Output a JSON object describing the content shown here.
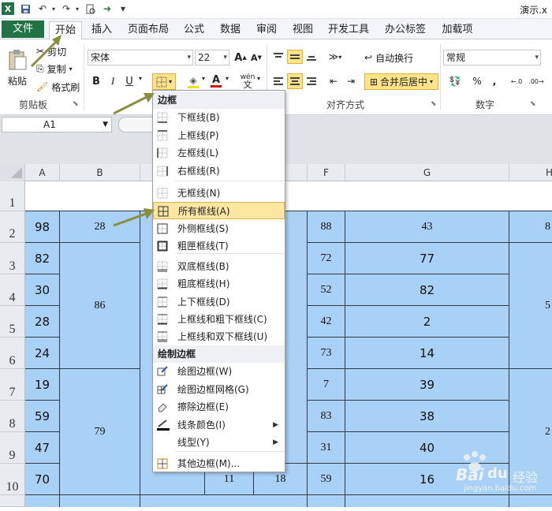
{
  "title_bar": {
    "app_title": "演示.x",
    "qat_icons": [
      "excel-app-icon",
      "save-icon",
      "undo-icon",
      "redo-icon",
      "print-preview-icon",
      "forward-icon",
      "customize-qat-icon"
    ]
  },
  "tabs": [
    "文件",
    "开始",
    "插入",
    "页面布局",
    "公式",
    "数据",
    "审阅",
    "视图",
    "开发工具",
    "办公标签",
    "加载项"
  ],
  "ribbon": {
    "clipboard": {
      "paste": "粘贴",
      "cut": "剪切",
      "copy": "复制",
      "format_painter": "格式刷",
      "group": "剪贴板"
    },
    "font": {
      "font_name": "宋体",
      "font_size": "22",
      "bold": "B",
      "italic": "I",
      "underline": "U",
      "grow": "A",
      "shrink": "A",
      "fill_label": "A",
      "font_color": "A",
      "phonetic": "wén"
    },
    "alignment": {
      "wrap_text": "自动换行",
      "merge_center": "合并后居中",
      "group": "对齐方式"
    },
    "number": {
      "format": "常规",
      "percent": "%",
      "comma": ",",
      "group": "数字"
    }
  },
  "formula_bar": {
    "name_box": "A1"
  },
  "columns": [
    "A",
    "B",
    "C",
    "D",
    "E",
    "F",
    "G",
    "H"
  ],
  "rows": [
    "1",
    "2",
    "3",
    "4",
    "5",
    "6",
    "7",
    "8",
    "9",
    "10"
  ],
  "cells": {
    "A": [
      "98",
      "82",
      "30",
      "28",
      "24",
      "19",
      "59",
      "47",
      "70"
    ],
    "B_merged": [
      "28",
      "86",
      "79"
    ],
    "D10": "11",
    "E10": "18",
    "F": [
      "88",
      "72",
      "52",
      "42",
      "73",
      "7",
      "83",
      "31",
      "59"
    ],
    "G": [
      "43",
      "77",
      "82",
      "2",
      "14",
      "39",
      "38",
      "40",
      "16"
    ],
    "H": [
      "8",
      "5",
      "2"
    ]
  },
  "menu": {
    "header_border": "边框",
    "items_border": [
      {
        "label": "下框线(B)",
        "icon": "bottom-border-icon"
      },
      {
        "label": "上框线(P)",
        "icon": "top-border-icon"
      },
      {
        "label": "左框线(L)",
        "icon": "left-border-icon"
      },
      {
        "label": "右框线(R)",
        "icon": "right-border-icon"
      },
      {
        "label": "无框线(N)",
        "icon": "no-border-icon"
      },
      {
        "label": "所有框线(A)",
        "icon": "all-borders-icon"
      },
      {
        "label": "外侧框线(S)",
        "icon": "outside-borders-icon"
      },
      {
        "label": "粗匣框线(T)",
        "icon": "thick-box-border-icon"
      },
      {
        "label": "双底框线(B)",
        "icon": "double-bottom-border-icon"
      },
      {
        "label": "粗底框线(H)",
        "icon": "thick-bottom-border-icon"
      },
      {
        "label": "上下框线(D)",
        "icon": "top-bottom-border-icon"
      },
      {
        "label": "上框线和粗下框线(C)",
        "icon": "top-thick-bottom-border-icon"
      },
      {
        "label": "上框线和双下框线(U)",
        "icon": "top-double-bottom-border-icon"
      }
    ],
    "header_draw": "绘制边框",
    "items_draw": [
      {
        "label": "绘图边框(W)",
        "icon": "draw-border-icon"
      },
      {
        "label": "绘图边框网格(G)",
        "icon": "draw-border-grid-icon"
      },
      {
        "label": "擦除边框(E)",
        "icon": "eraser-icon"
      },
      {
        "label": "线条颜色(I)",
        "icon": "line-color-icon"
      },
      {
        "label": "线型(Y)",
        "icon": "line-style-icon"
      },
      {
        "label": "其他边框(M)...",
        "icon": "more-borders-icon"
      }
    ]
  },
  "watermark": {
    "brand": "Bai",
    "brand2": "经验",
    "sub": "jingyan.baidu.com"
  },
  "colors": {
    "cell_fill": "#a9d0f5",
    "file_tab": "#217346",
    "highlight": "#fde7a3",
    "arrow": "#8a8f3e"
  }
}
